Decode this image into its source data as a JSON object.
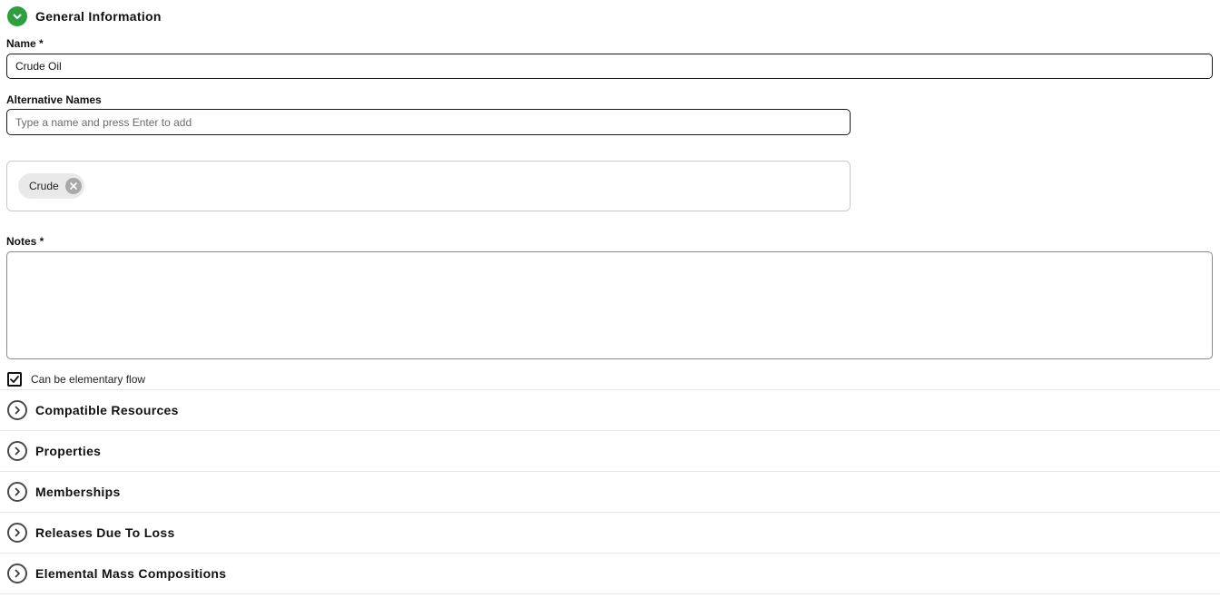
{
  "general": {
    "title": "General Information",
    "icon": "chevron-down-icon",
    "accent_color": "#2e9f3e"
  },
  "name_field": {
    "label": "Name *",
    "value": "Crude Oil"
  },
  "alt_names": {
    "label": "Alternative Names",
    "placeholder": "Type a name and press Enter to add",
    "chips": [
      "Crude"
    ]
  },
  "notes_field": {
    "label": "Notes *",
    "value": ""
  },
  "elementary_flow": {
    "label": "Can be elementary flow",
    "checked": true
  },
  "sections": [
    {
      "title": "Compatible Resources",
      "icon": "chevron-right-icon"
    },
    {
      "title": "Properties",
      "icon": "chevron-right-icon"
    },
    {
      "title": "Memberships",
      "icon": "chevron-right-icon"
    },
    {
      "title": "Releases Due To Loss",
      "icon": "chevron-right-icon"
    },
    {
      "title": "Elemental Mass Compositions",
      "icon": "chevron-right-icon"
    }
  ]
}
